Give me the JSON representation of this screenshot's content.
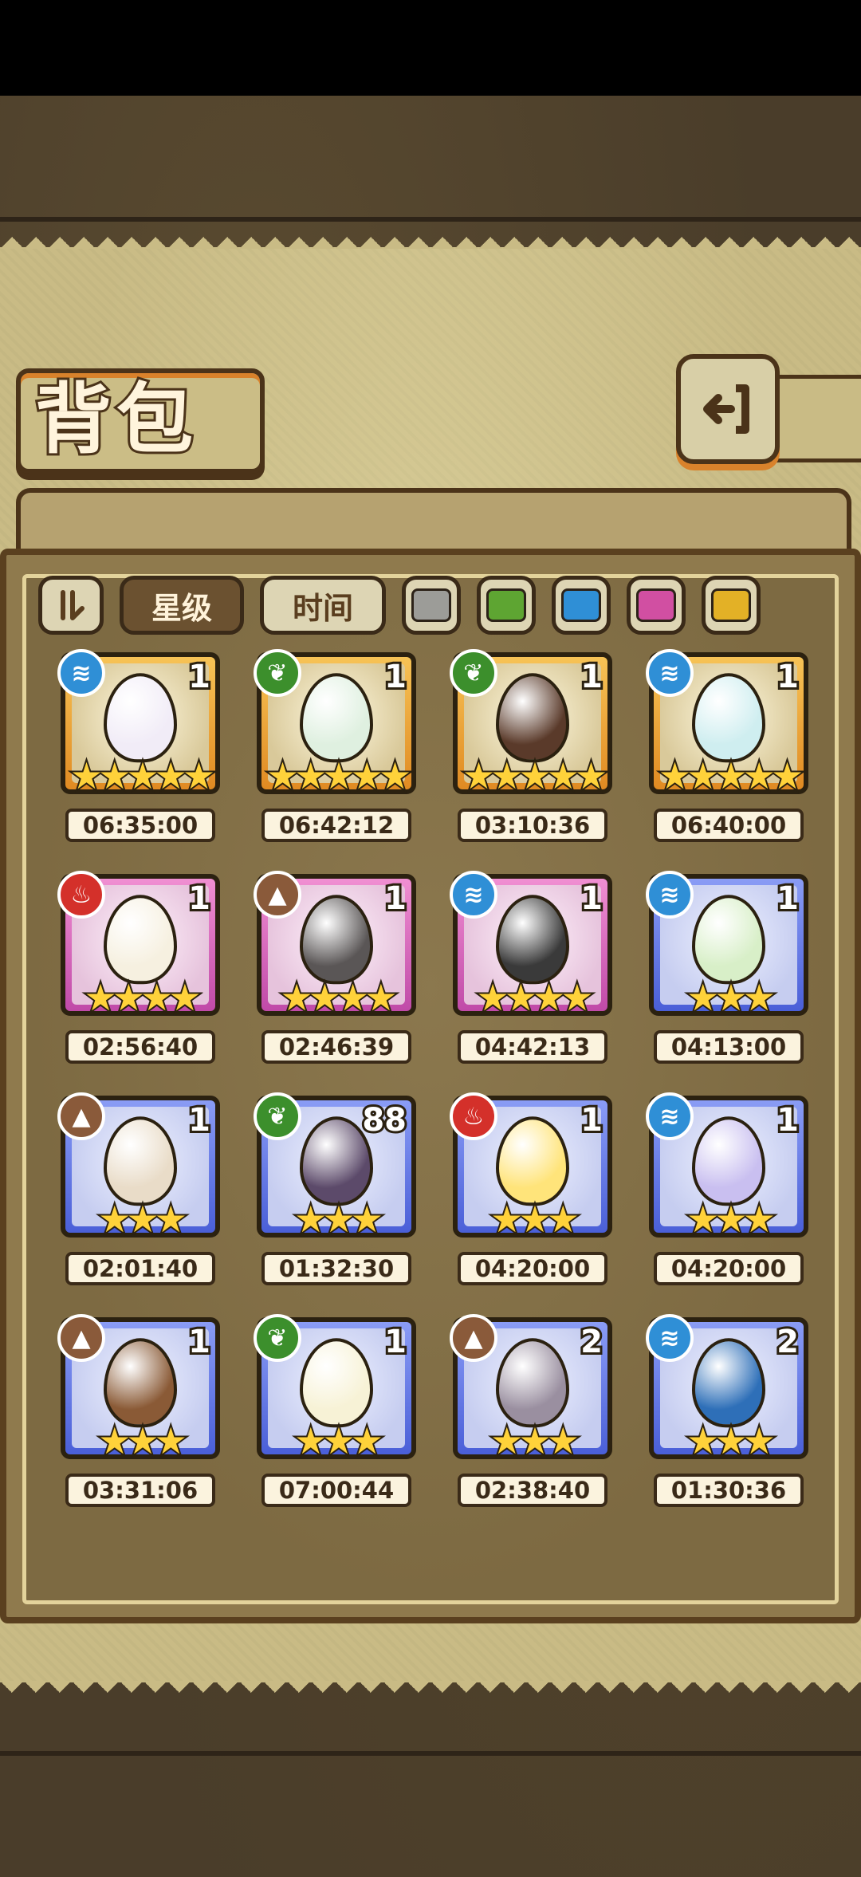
{
  "page": {
    "title": "背包"
  },
  "filters": {
    "toggle_icon": "collapse-icon",
    "sort_star": "星级",
    "sort_time": "时间",
    "colors": [
      "#9c9c98",
      "#5ea532",
      "#2f8fd6",
      "#d14fa2",
      "#e3b126"
    ]
  },
  "element_colors": {
    "water": "#2f8fd6",
    "leaf": "#3c8f2c",
    "fire": "#d4302a",
    "earth": "#8a5a3a"
  },
  "items": [
    {
      "element": "water",
      "count": "1",
      "stars": "★★★★★",
      "rarity": "r5",
      "egg": "#f1ecf7",
      "timer": "06:35:00"
    },
    {
      "element": "leaf",
      "count": "1",
      "stars": "★★★★★",
      "rarity": "r5",
      "egg": "#dff0e0",
      "timer": "06:42:12"
    },
    {
      "element": "leaf",
      "count": "1",
      "stars": "★★★★★",
      "rarity": "r5",
      "egg": "#5a3a2a",
      "timer": "03:10:36"
    },
    {
      "element": "water",
      "count": "1",
      "stars": "★★★★★",
      "rarity": "r5",
      "egg": "#cfeef0",
      "timer": "06:40:00"
    },
    {
      "element": "fire",
      "count": "1",
      "stars": "★★★★",
      "rarity": "r4",
      "egg": "#f6f0e0",
      "timer": "02:56:40"
    },
    {
      "element": "earth",
      "count": "1",
      "stars": "★★★★",
      "rarity": "r4",
      "egg": "#5a5656",
      "timer": "02:46:39"
    },
    {
      "element": "water",
      "count": "1",
      "stars": "★★★★",
      "rarity": "r4",
      "egg": "#3a3a3a",
      "timer": "04:42:13"
    },
    {
      "element": "water",
      "count": "1",
      "stars": "★★★",
      "rarity": "r3",
      "egg": "#d8efc8",
      "timer": "04:13:00"
    },
    {
      "element": "earth",
      "count": "1",
      "stars": "★★★",
      "rarity": "r3",
      "egg": "#e9dcc8",
      "timer": "02:01:40"
    },
    {
      "element": "leaf",
      "count": "88",
      "stars": "★★★",
      "rarity": "r3",
      "egg": "#5c4a6a",
      "timer": "01:32:30"
    },
    {
      "element": "fire",
      "count": "1",
      "stars": "★★★",
      "rarity": "r3",
      "egg": "#ffe47a",
      "timer": "04:20:00"
    },
    {
      "element": "water",
      "count": "1",
      "stars": "★★★",
      "rarity": "r3",
      "egg": "#c9bff0",
      "timer": "04:20:00"
    },
    {
      "element": "earth",
      "count": "1",
      "stars": "★★★",
      "rarity": "r3",
      "egg": "#8a5a36",
      "timer": "03:31:06"
    },
    {
      "element": "leaf",
      "count": "1",
      "stars": "★★★",
      "rarity": "r3",
      "egg": "#f7f2d6",
      "timer": "07:00:44"
    },
    {
      "element": "earth",
      "count": "2",
      "stars": "★★★",
      "rarity": "r3",
      "egg": "#9a8fa0",
      "timer": "02:38:40"
    },
    {
      "element": "water",
      "count": "2",
      "stars": "★★★",
      "rarity": "r3",
      "egg": "#2e6fb8",
      "timer": "01:30:36"
    }
  ]
}
